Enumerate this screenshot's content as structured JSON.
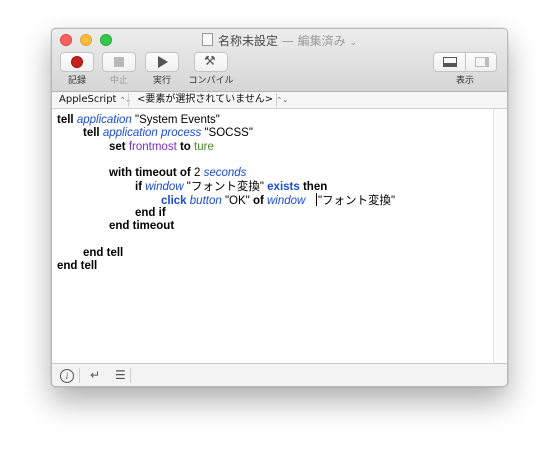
{
  "window": {
    "title": "名称未設定",
    "title_separator": "—",
    "title_status": "編集済み",
    "title_caret": "⌄"
  },
  "toolbar": {
    "record_label": "記録",
    "stop_label": "中止",
    "run_label": "実行",
    "compile_label": "コンパイル",
    "view_label": "表示"
  },
  "navigation": {
    "language": "AppleScript",
    "element_selector": "<要素が選択されていません>",
    "updown_glyph": "⌃⌄"
  },
  "script_lines": [
    [
      {
        "t": "tell",
        "c": "kw"
      },
      {
        "t": " "
      },
      {
        "t": "application",
        "c": "app"
      },
      {
        "t": " \"System Events\""
      }
    ],
    [
      {
        "t": "tell",
        "c": "kw"
      },
      {
        "t": " "
      },
      {
        "t": "application process",
        "c": "app"
      },
      {
        "t": " \"SOCSS\""
      }
    ],
    [
      {
        "t": "set",
        "c": "kw"
      },
      {
        "t": " "
      },
      {
        "t": "frontmost",
        "c": "prop"
      },
      {
        "t": " "
      },
      {
        "t": "to",
        "c": "kw"
      },
      {
        "t": " "
      },
      {
        "t": "ture",
        "c": "val"
      }
    ],
    [],
    [
      {
        "t": "with timeout of",
        "c": "kw"
      },
      {
        "t": " 2 "
      },
      {
        "t": "seconds",
        "c": "ital"
      }
    ],
    [
      {
        "t": "if",
        "c": "kw"
      },
      {
        "t": " "
      },
      {
        "t": "window",
        "c": "app"
      },
      {
        "t": " \"フォント変換\" "
      },
      {
        "t": "exists",
        "c": "cmd"
      },
      {
        "t": " "
      },
      {
        "t": "then",
        "c": "kw"
      }
    ],
    [
      {
        "t": "click",
        "c": "cmd"
      },
      {
        "t": " "
      },
      {
        "t": "button",
        "c": "app"
      },
      {
        "t": " \"OK\" "
      },
      {
        "t": "of",
        "c": "kw"
      },
      {
        "t": " "
      },
      {
        "t": "window",
        "c": "app"
      },
      {
        "t": "   "
      },
      {
        "t": "",
        "c": "caret"
      },
      {
        "t": "\"フォント変換\""
      }
    ],
    [
      {
        "t": "end if",
        "c": "kw"
      }
    ],
    [
      {
        "t": "end timeout",
        "c": "kw"
      }
    ],
    [],
    [
      {
        "t": "end tell",
        "c": "kw"
      }
    ],
    [
      {
        "t": "end tell",
        "c": "kw"
      }
    ]
  ],
  "bottombar": {
    "info_icon_glyph": "i",
    "return_icon_glyph": "↵",
    "list_icon_glyph": "☰"
  },
  "colors": {
    "keyword": "#000000",
    "application_class": "#1a4bd6",
    "property": "#7a2ec9",
    "value": "#4b8a2b",
    "record_button": "#c8201a",
    "close_light": "#fc605c",
    "minimize_light": "#fdbc40",
    "zoom_light": "#34c84a"
  }
}
